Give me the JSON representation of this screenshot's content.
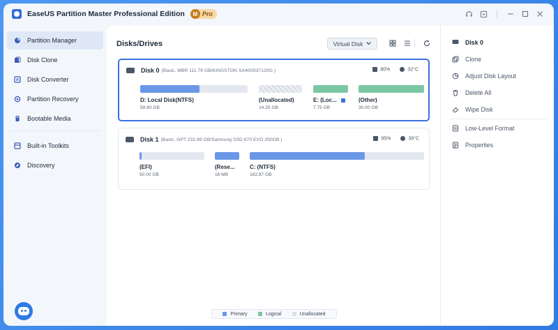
{
  "app": {
    "title": "EaseUS Partition Master Professional Edition",
    "badge_letter": "M",
    "badge_text": "Pro"
  },
  "sidebar": {
    "items": [
      {
        "label": "Partition Manager",
        "icon": "partition-manager-icon",
        "active": true
      },
      {
        "label": "Disk Clone",
        "icon": "disk-clone-icon"
      },
      {
        "label": "Disk Converter",
        "icon": "disk-converter-icon"
      },
      {
        "label": "Partition Recovery",
        "icon": "partition-recovery-icon"
      },
      {
        "label": "Bootable Media",
        "icon": "bootable-media-icon"
      },
      {
        "label": "Built-in Toolkits",
        "icon": "toolkits-icon"
      },
      {
        "label": "Discovery",
        "icon": "discovery-icon"
      }
    ]
  },
  "main": {
    "title": "Disks/Drives",
    "virtual_disk_label": "Virtual Disk"
  },
  "disks": [
    {
      "name": "Disk 0",
      "info": "(Basic, MBR 111.79 GB/KINGSTON SA400S37120G )",
      "health": "80%",
      "temperature": "32°C",
      "partitions": [
        {
          "label": "D: Local Disk(NTFS)",
          "size": "59.80 GB",
          "used_fraction": 0.55,
          "kind": "primary"
        },
        {
          "label": "(Unallocated)",
          "size": "14.25 GB",
          "used_fraction": 1.0,
          "kind": "unallocated"
        },
        {
          "label": "E: (Loc...",
          "size": "7.75 GB",
          "used_fraction": 1.0,
          "kind": "logical",
          "locked": true
        },
        {
          "label": "(Other)",
          "size": "30.00 GB",
          "used_fraction": 1.0,
          "kind": "logical"
        }
      ]
    },
    {
      "name": "Disk 1",
      "info": "(Basic, GPT 232.89 GB/Samsung SSD 870 EVO 250GB )",
      "health": "95%",
      "temperature": "39°C",
      "partitions": [
        {
          "label": "(EFI)",
          "size": "50.00 GB",
          "used_fraction": 0.03,
          "kind": "primary"
        },
        {
          "label": "(Rese...",
          "size": "16 MB",
          "used_fraction": 1.0,
          "kind": "primary"
        },
        {
          "label": "C: (NTFS)",
          "size": "182.87 GB",
          "used_fraction": 0.66,
          "kind": "primary"
        }
      ]
    }
  ],
  "legend": {
    "primary": "Primary",
    "logical": "Logical",
    "unallocated": "Unallocated",
    "colors": {
      "primary": "#6a98e6",
      "logical": "#7cc7a3"
    }
  },
  "right_panel": {
    "heading": "Disk 0",
    "actions": [
      {
        "label": "Clone",
        "icon": "clone-icon"
      },
      {
        "label": "Adjust Disk Layout",
        "icon": "adjust-layout-icon"
      },
      {
        "label": "Delete All",
        "icon": "trash-icon"
      },
      {
        "label": "Wipe Disk",
        "icon": "eraser-icon"
      },
      {
        "label": "Low-Level Format",
        "icon": "format-icon"
      },
      {
        "label": "Properties",
        "icon": "properties-icon"
      }
    ]
  }
}
